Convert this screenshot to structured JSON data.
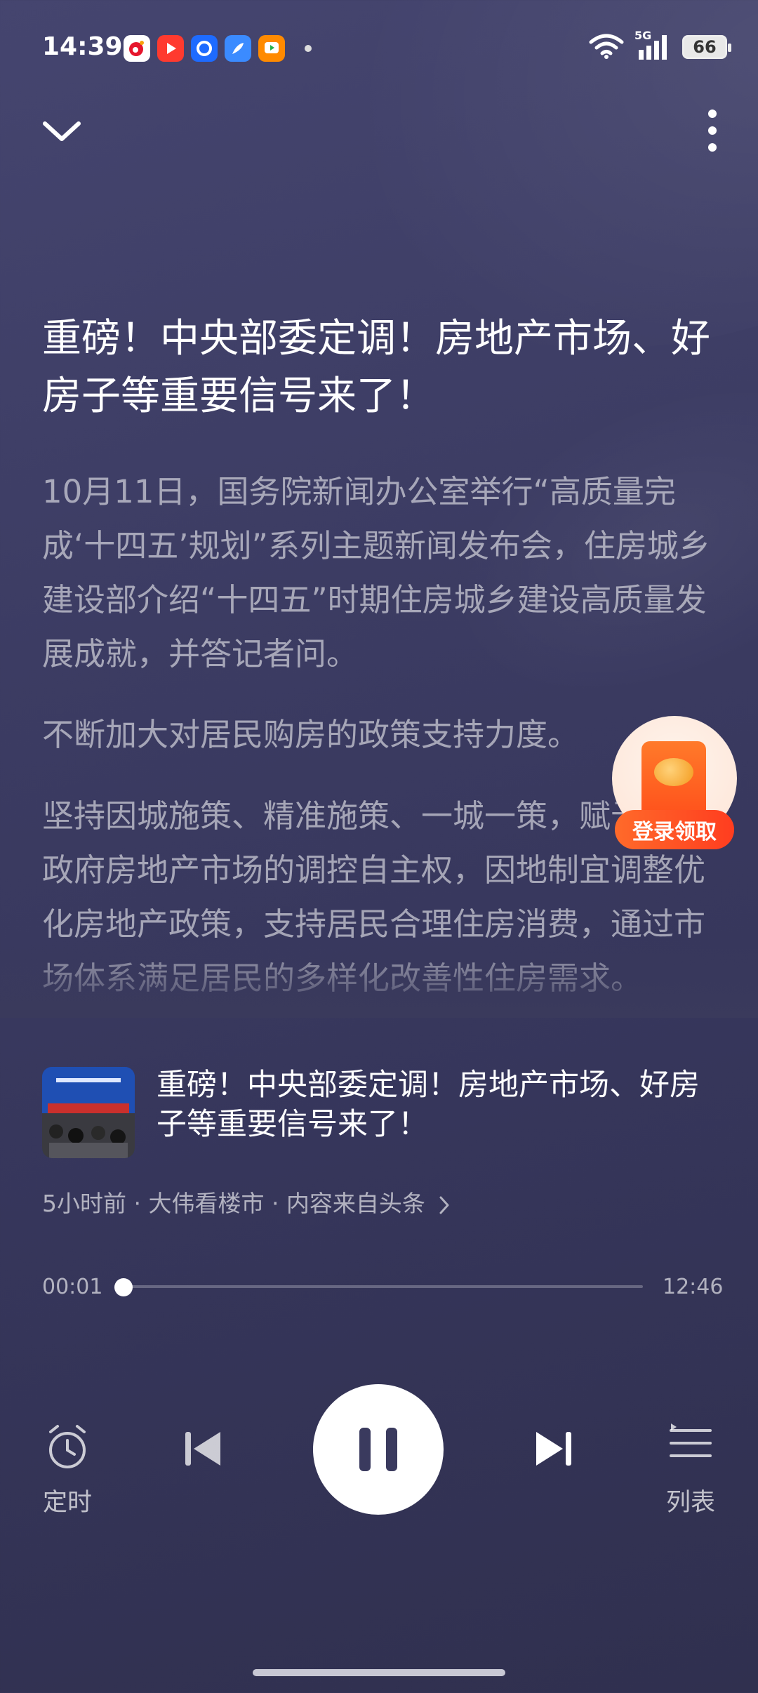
{
  "status_bar": {
    "time": "14:39",
    "network": "5G",
    "battery": "66",
    "app_icons": [
      "weibo-icon",
      "video-icon",
      "browser-icon",
      "feather-icon",
      "video-player-icon"
    ]
  },
  "article": {
    "title": "重磅！中央部委定调！房地产市场、好房子等重要信号来了！",
    "paragraphs": [
      "10月11日，国务院新闻办公室举行“高质量完成‘十四五’规划”系列主题新闻发布会，住房城乡建设部介绍“十四五”时期住房城乡建设高质量发展成就，并答记者问。",
      "不断加大对居民购房的政策支持力度。",
      "坚持因城施策、精准施策、一城一策，赋予城市政府房地产市场的调控自主权，因地制宜调整优化房地产政策，支持居民合理住房消费，通过市场体系满足居民的多样化改善性住房需求。"
    ]
  },
  "promo": {
    "label": "登录领取"
  },
  "now_playing": {
    "title": "重磅！中央部委定调！房地产市场、好房子等重要信号来了！",
    "meta": "5小时前 · 大伟看楼市 · 内容来自头条"
  },
  "progress": {
    "current": "00:01",
    "total": "12:46",
    "fraction": 0.008
  },
  "controls": {
    "timer_label": "定时",
    "list_label": "列表"
  },
  "colors": {
    "background": "#3b3b61",
    "promo_orange": "#ff5a22"
  }
}
